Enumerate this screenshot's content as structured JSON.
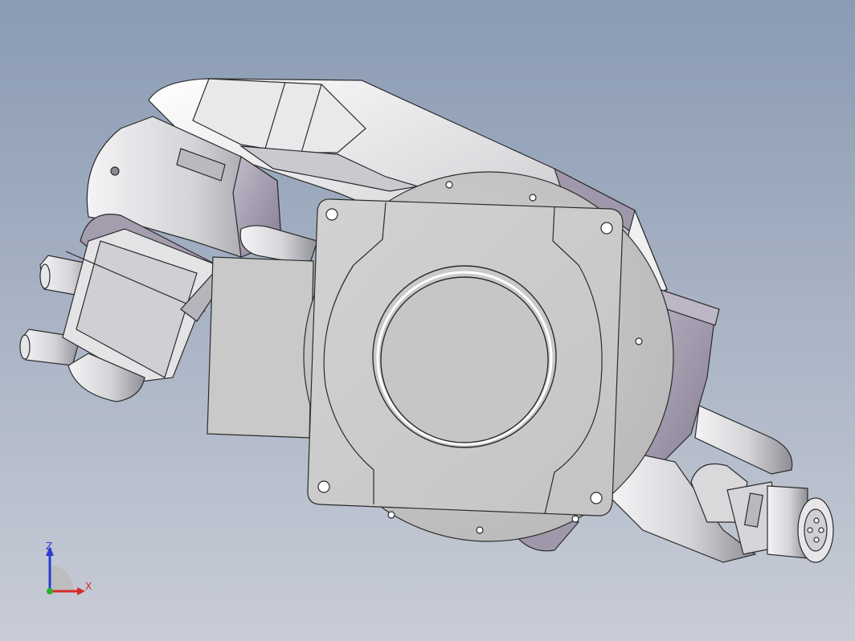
{
  "viewport": {
    "background_top": "#8a9bb3",
    "background_bottom": "#c8ccd6"
  },
  "model": {
    "description_icon": "robot-arm-cad-model",
    "body_color": "#cfcfd2",
    "shadow_color": "#9f98aa"
  },
  "triad": {
    "z_label": "Z",
    "x_label": "X",
    "z_color": "#2a3bd6",
    "x_color": "#d62a2a",
    "y_color": "#2ab02a"
  }
}
